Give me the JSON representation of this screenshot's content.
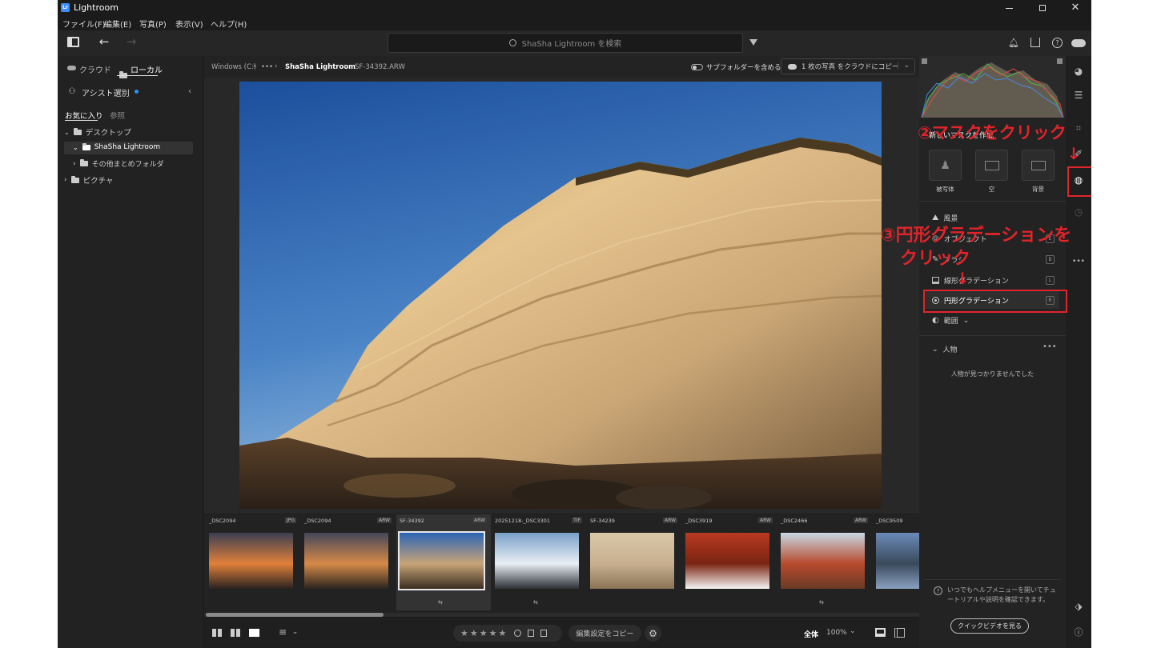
{
  "app": {
    "name": "Lightroom"
  },
  "menu": [
    "ファイル(F)",
    "編集(E)",
    "写真(P)",
    "表示(V)",
    "ヘルプ(H)"
  ],
  "search": {
    "placeholder": "ShaSha Lightroom を検索"
  },
  "left_panel": {
    "tabs": [
      "クラウド",
      "ローカル"
    ],
    "assist_label": "アシスト選別",
    "subtabs": [
      "お気に入り",
      "参照"
    ],
    "folders": [
      "デスクトップ",
      "ShaSha Lightroom",
      "その他まとめフォルダ",
      "ピクチャ"
    ]
  },
  "breadcrumb": {
    "drive": "Windows (C:)",
    "ellipsis": "•••",
    "folder": "ShaSha Lightroom",
    "file": "SF-34392.ARW"
  },
  "subfolder_label": "サブフォルダーを含める",
  "copy_to_cloud": "1 枚の写真 をクラウドにコピー",
  "filmstrip": [
    {
      "name": "_DSC2094",
      "ext": "JPG",
      "edited": false,
      "colors": [
        "#3a3e52",
        "#e0803a",
        "#2a2220"
      ]
    },
    {
      "name": "_DSC2094",
      "ext": "ARW",
      "edited": false,
      "colors": [
        "#42465a",
        "#d68a48",
        "#2a2420"
      ]
    },
    {
      "name": "SF-34392",
      "ext": "ARW",
      "edited": true,
      "colors": [
        "#2a64b4",
        "#c8a478",
        "#3a2c20"
      ]
    },
    {
      "name": "20251218-_DSC3301",
      "ext": "TIF",
      "edited": true,
      "colors": [
        "#7aa0c8",
        "#e8eef4",
        "#2a3034"
      ]
    },
    {
      "name": "SF-34239",
      "ext": "ARW",
      "edited": false,
      "colors": [
        "#d8c8a8",
        "#c8b090",
        "#8a7456"
      ]
    },
    {
      "name": "_DSC3919",
      "ext": "ARW",
      "edited": false,
      "colors": [
        "#b83a22",
        "#7a2412",
        "#f4f4f4"
      ]
    },
    {
      "name": "_DSC2466",
      "ext": "ARW",
      "edited": true,
      "colors": [
        "#c8d8e4",
        "#b84a2e",
        "#6a3a24"
      ]
    },
    {
      "name": "_DSC9509",
      "ext": "",
      "edited": false,
      "colors": [
        "#6a8ab8",
        "#3a4a5c",
        "#8aa0c0"
      ]
    }
  ],
  "bottom": {
    "stars": "★★★★★",
    "copy_settings": "編集設定をコピー",
    "fit_label": "全体",
    "zoom": "100%"
  },
  "masking": {
    "title": "新しいマスクを作成",
    "quick": [
      "被写体",
      "空",
      "背景"
    ],
    "tools": [
      {
        "label": "風景",
        "key": ""
      },
      {
        "label": "オブジェクト",
        "key": "E"
      },
      {
        "label": "ブラシ",
        "key": "B"
      },
      {
        "label": "線形グラデーション",
        "key": "L"
      },
      {
        "label": "円形グラデーション",
        "key": "R"
      },
      {
        "label": "範囲",
        "key": ""
      }
    ],
    "people_header": "人物",
    "people_empty": "人物が見つかりませんでした",
    "help_text": "いつでもヘルプメニューを開いてチュートリアルや説明を確認できます。",
    "video_button": "クイックビデオを見る"
  },
  "annotations": {
    "step2": "②マスクをクリック",
    "step3_line1": "③円形グラデーションを",
    "step3_line2": "クリック",
    "color": "#e0242a"
  }
}
